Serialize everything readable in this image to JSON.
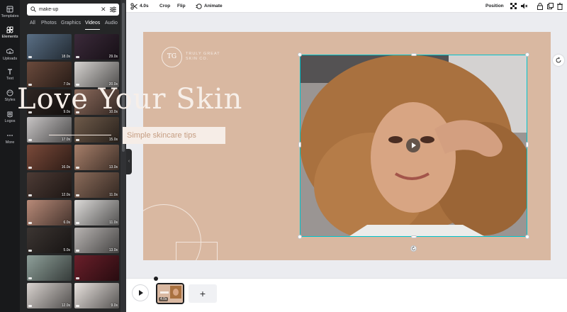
{
  "rail": [
    {
      "label": "Templates",
      "icon": "templates-icon"
    },
    {
      "label": "Elements",
      "icon": "elements-icon",
      "active": true
    },
    {
      "label": "Uploads",
      "icon": "uploads-icon"
    },
    {
      "label": "Text",
      "icon": "text-icon"
    },
    {
      "label": "Styles",
      "icon": "styles-icon"
    },
    {
      "label": "Logos",
      "icon": "logos-icon"
    },
    {
      "label": "More",
      "icon": "more-icon"
    }
  ],
  "search": {
    "value": "make-up"
  },
  "tabs": [
    "All",
    "Photos",
    "Graphics",
    "Videos",
    "Audio"
  ],
  "active_tab": "Videos",
  "thumbnails": [
    {
      "duration": "18.0s",
      "color": "#5a6f85"
    },
    {
      "duration": "29.0s",
      "color": "#3b2a3a"
    },
    {
      "duration": "7.0s",
      "color": "#6a4a3c"
    },
    {
      "duration": "20.0s",
      "color": "#d6d3d0"
    },
    {
      "duration": "9.0s",
      "color": "#2f2622"
    },
    {
      "duration": "10.0s",
      "color": "#8b6a5c"
    },
    {
      "duration": "17.0s",
      "color": "#c7c4c4"
    },
    {
      "duration": "15.0s",
      "color": "#6e5a4a"
    },
    {
      "duration": "16.0s",
      "color": "#7a4a3a"
    },
    {
      "duration": "13.0s",
      "color": "#a77f6a"
    },
    {
      "duration": "12.0s",
      "color": "#4d3b35"
    },
    {
      "duration": "11.0s",
      "color": "#8a6b5a"
    },
    {
      "duration": "6.0s",
      "color": "#b88a78"
    },
    {
      "duration": "11.0s",
      "color": "#dcdad8"
    },
    {
      "duration": "5.0s",
      "color": "#3c3532"
    },
    {
      "duration": "13.0s",
      "color": "#b8b4b2"
    },
    {
      "duration": "",
      "color": "#8fa09a"
    },
    {
      "duration": "",
      "color": "#6a1f2a"
    },
    {
      "duration": "12.0s",
      "color": "#d9d3cf"
    },
    {
      "duration": "9.0s",
      "color": "#e8e2de"
    }
  ],
  "toolbar": {
    "duration": "4.0s",
    "crop": "Crop",
    "flip": "Flip",
    "animate": "Animate",
    "position": "Position"
  },
  "design": {
    "logo_initials": "TG",
    "brand_line1": "TRULY GREAT",
    "brand_line2": "SKIN CO.",
    "headline": "Love Your Skin",
    "subtitle": "Simple skincare tips"
  },
  "timeline": {
    "clip_duration": "4.0s",
    "add_label": "+"
  },
  "colors": {
    "canvas_bg": "#d9b8a1",
    "selection": "#00c4cc",
    "sidebar_bg": "#252627",
    "rail_bg": "#18191b"
  }
}
